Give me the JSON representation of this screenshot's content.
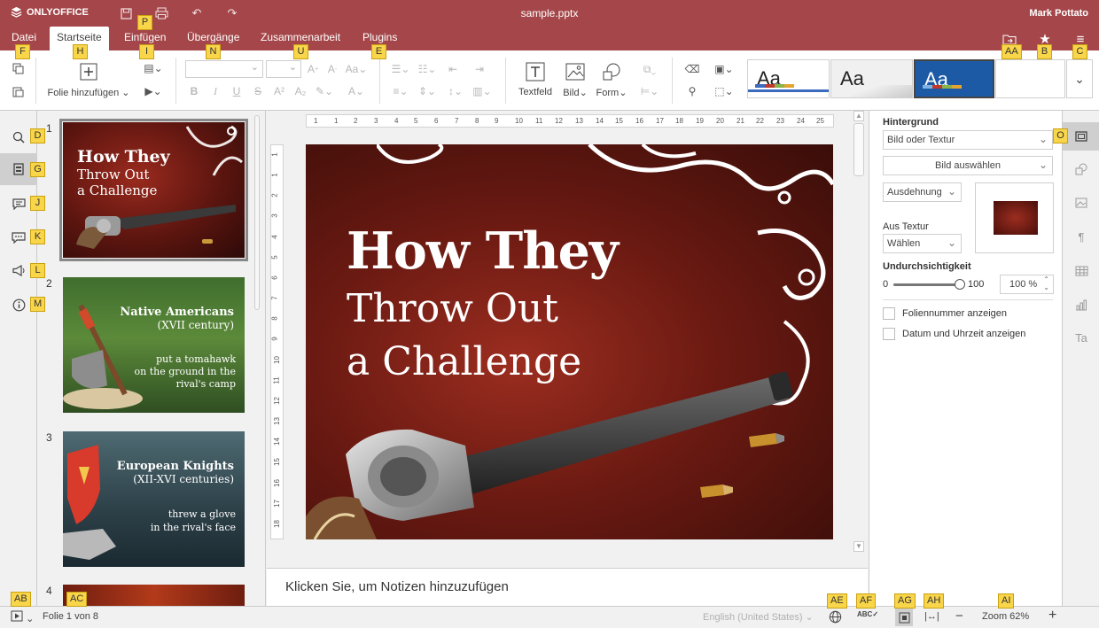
{
  "app": {
    "brand": "ONLYOFFICE",
    "doc_title": "sample.pptx",
    "user": "Mark Pottato"
  },
  "menu": {
    "tabs": [
      {
        "label": "Datei"
      },
      {
        "label": "Startseite"
      },
      {
        "label": "Einfügen"
      },
      {
        "label": "Übergänge"
      },
      {
        "label": "Zusammenarbeit"
      },
      {
        "label": "Plugins"
      }
    ],
    "active_tab": "Startseite"
  },
  "toolbar": {
    "add_slide_label": "Folie hinzufügen",
    "textbox_label": "Textfeld",
    "image_label": "Bild",
    "shape_label": "Form",
    "theme_sample": "Aa"
  },
  "slides": [
    {
      "number": "1",
      "title_line1": "How They",
      "title_line2": "Throw Out",
      "title_line3": "a Challenge"
    },
    {
      "number": "2",
      "heading": "Native Americans",
      "subheading": "(XVII century)",
      "text_line1": "put a tomahawk",
      "text_line2": "on the ground in the",
      "text_line3": "rival's camp"
    },
    {
      "number": "3",
      "heading": "European Knights",
      "subheading": "(XII-XVI centuries)",
      "text_line1": "threw a glove",
      "text_line2": "in the rival's face"
    },
    {
      "number": "4"
    }
  ],
  "notes_placeholder": "Klicken Sie, um Notizen hinzuzufügen",
  "ruler": {
    "h_labels": [
      "1",
      "1",
      "2",
      "3",
      "4",
      "5",
      "6",
      "7",
      "8",
      "9",
      "10",
      "11",
      "12",
      "13",
      "14",
      "15",
      "16",
      "17",
      "18",
      "19",
      "20",
      "21",
      "22",
      "23",
      "24",
      "25"
    ],
    "v_labels": [
      "1",
      "1",
      "2",
      "3",
      "4",
      "5",
      "6",
      "7",
      "8",
      "9",
      "10",
      "11",
      "12",
      "13",
      "14",
      "15",
      "16",
      "17",
      "18"
    ]
  },
  "right_panel": {
    "background_label": "Hintergrund",
    "fill_type": "Bild oder Textur",
    "select_image_button": "Bild auswählen",
    "stretch_value": "Ausdehnung",
    "from_texture_label": "Aus Textur",
    "texture_value": "Wählen",
    "opacity_label": "Undurchsichtigkeit",
    "opacity_min": "0",
    "opacity_max": "100",
    "opacity_value": "100 %",
    "opacity_percent": 100,
    "show_slide_number_label": "Foliennummer anzeigen",
    "show_date_time_label": "Datum und Uhrzeit anzeigen",
    "show_slide_number_checked": false,
    "show_date_time_checked": false
  },
  "status": {
    "slide_counter": "Folie 1 von 8",
    "language": "English (United States)",
    "zoom_label": "Zoom 62%"
  },
  "badges": {
    "datei": "F",
    "startseite": "H",
    "einfuegen_top": "P",
    "einfuegen": "I",
    "uebergaenge": "N",
    "zusammenarbeit": "U",
    "plugins": "E",
    "open_location": "AA",
    "favorite": "B",
    "menu": "C",
    "search": "D",
    "slides": "G",
    "comments": "J",
    "chat": "K",
    "feedback": "L",
    "about": "M",
    "slide_settings": "O",
    "start_slideshow": "AB",
    "slide_counter": "AC",
    "language": "AE",
    "spellcheck": "AF",
    "fit_slide": "AG",
    "fit_width": "AH",
    "zoom": "AI"
  },
  "colors": {
    "accent": "#a5474a",
    "badge": "#f9d54a"
  }
}
